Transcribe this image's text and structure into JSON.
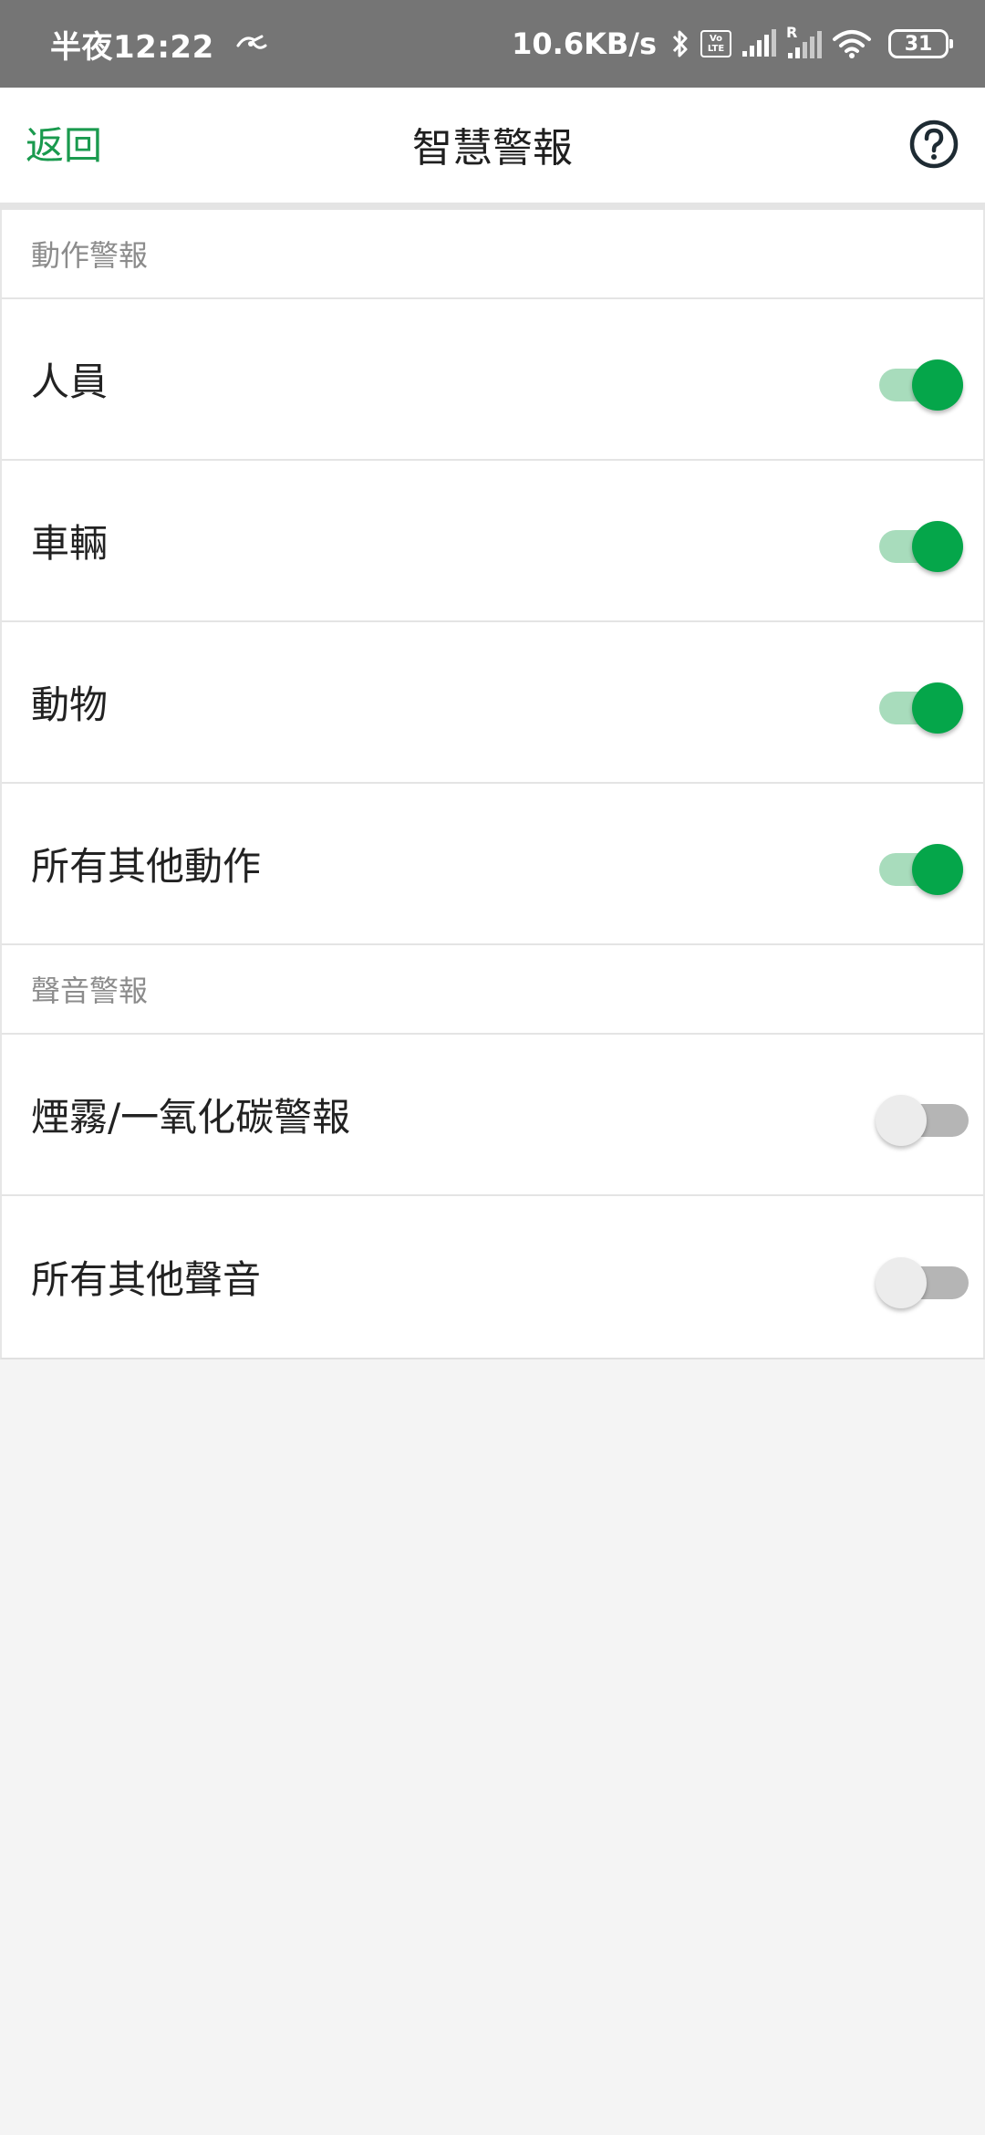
{
  "status_bar": {
    "time": "半夜12:22",
    "net_speed": "10.6KB/s",
    "volte_top": "Vo",
    "volte_bottom": "LTE",
    "roaming": "R",
    "battery": "31"
  },
  "nav": {
    "back_label": "返回",
    "title": "智慧警報",
    "accent_color": "#1a9a4e"
  },
  "sections": [
    {
      "header": "動作警報",
      "items": [
        {
          "label": "人員",
          "enabled": true
        },
        {
          "label": "車輛",
          "enabled": true
        },
        {
          "label": "動物",
          "enabled": true
        },
        {
          "label": "所有其他動作",
          "enabled": true
        }
      ]
    },
    {
      "header": "聲音警報",
      "items": [
        {
          "label": "煙霧/一氧化碳警報",
          "enabled": false
        },
        {
          "label": "所有其他聲音",
          "enabled": false
        }
      ]
    }
  ],
  "colors": {
    "toggle_on": "#05a64a",
    "toggle_on_track": "#a8dcbc",
    "toggle_off_track": "#b5b5b5"
  }
}
